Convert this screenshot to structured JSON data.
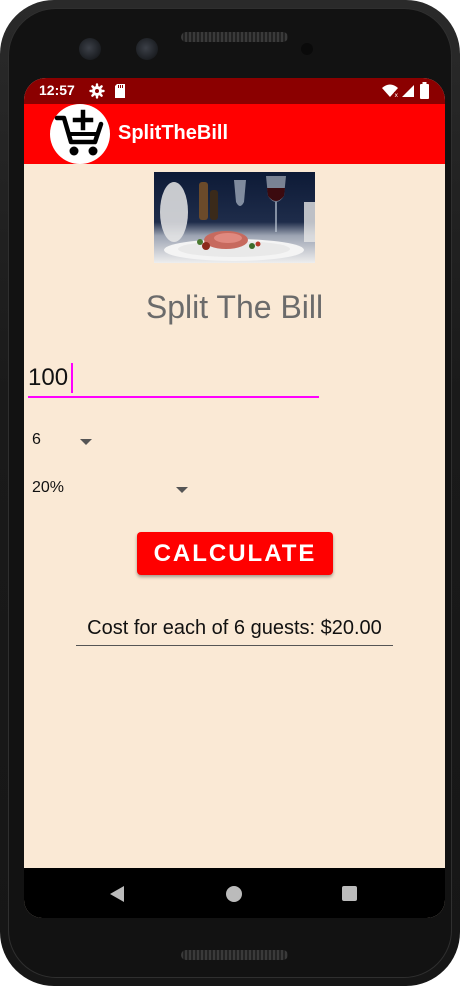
{
  "status_bar": {
    "time": "12:57",
    "icons": [
      "gear-icon",
      "sd-card-icon",
      "wifi-icon",
      "signal-icon",
      "battery-icon"
    ]
  },
  "app_bar": {
    "title": "SplitTheBill",
    "logo_icon": "add-to-cart-icon",
    "background": "#ff0000"
  },
  "main": {
    "title": "Split The Bill",
    "bill_amount_value": "100",
    "guests_spinner_value": "6",
    "tip_spinner_value": "20%",
    "calculate_label": "CALCULATE",
    "result_text": "Cost for each of 6 guests: $20.00"
  },
  "colors": {
    "screen_background": "#fae9d5",
    "status_bar": "#8b0000",
    "accent": "#ff00ff",
    "button": "#ff0000"
  },
  "nav_bar": {
    "icons": [
      "back-icon",
      "home-icon",
      "recents-icon"
    ]
  }
}
